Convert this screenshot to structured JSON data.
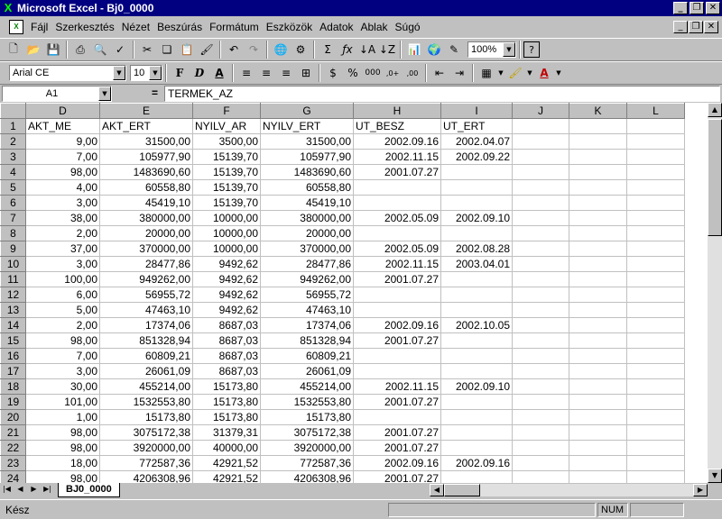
{
  "window": {
    "title": "Microsoft Excel - Bj0_0000"
  },
  "menu": [
    "Fájl",
    "Szerkesztés",
    "Nézet",
    "Beszúrás",
    "Formátum",
    "Eszközök",
    "Adatok",
    "Ablak",
    "Súgó"
  ],
  "toolbar": {
    "zoom": "100%",
    "font": "Arial CE",
    "size": "10",
    "bold": "F",
    "italic": "D",
    "underline": "A"
  },
  "formula": {
    "cell_ref": "A1",
    "equals": "=",
    "content": "TERMEK_AZ"
  },
  "columns": [
    "D",
    "E",
    "F",
    "G",
    "H",
    "I",
    "J",
    "K",
    "L"
  ],
  "rows": [
    {
      "n": "1",
      "c": [
        "AKT_ME",
        "AKT_ERT",
        "NYILV_AR",
        "NYILV_ERT",
        "UT_BESZ",
        "UT_ERT",
        "",
        "",
        ""
      ]
    },
    {
      "n": "2",
      "c": [
        "9,00",
        "31500,00",
        "3500,00",
        "31500,00",
        "2002.09.16",
        "2002.04.07",
        "",
        "",
        ""
      ]
    },
    {
      "n": "3",
      "c": [
        "7,00",
        "105977,90",
        "15139,70",
        "105977,90",
        "2002.11.15",
        "2002.09.22",
        "",
        "",
        ""
      ]
    },
    {
      "n": "4",
      "c": [
        "98,00",
        "1483690,60",
        "15139,70",
        "1483690,60",
        "2001.07.27",
        "",
        "",
        "",
        ""
      ]
    },
    {
      "n": "5",
      "c": [
        "4,00",
        "60558,80",
        "15139,70",
        "60558,80",
        "",
        "",
        "",
        "",
        ""
      ]
    },
    {
      "n": "6",
      "c": [
        "3,00",
        "45419,10",
        "15139,70",
        "45419,10",
        "",
        "",
        "",
        "",
        ""
      ]
    },
    {
      "n": "7",
      "c": [
        "38,00",
        "380000,00",
        "10000,00",
        "380000,00",
        "2002.05.09",
        "2002.09.10",
        "",
        "",
        ""
      ]
    },
    {
      "n": "8",
      "c": [
        "2,00",
        "20000,00",
        "10000,00",
        "20000,00",
        "",
        "",
        "",
        "",
        ""
      ]
    },
    {
      "n": "9",
      "c": [
        "37,00",
        "370000,00",
        "10000,00",
        "370000,00",
        "2002.05.09",
        "2002.08.28",
        "",
        "",
        ""
      ]
    },
    {
      "n": "10",
      "c": [
        "3,00",
        "28477,86",
        "9492,62",
        "28477,86",
        "2002.11.15",
        "2003.04.01",
        "",
        "",
        ""
      ]
    },
    {
      "n": "11",
      "c": [
        "100,00",
        "949262,00",
        "9492,62",
        "949262,00",
        "2001.07.27",
        "",
        "",
        "",
        ""
      ]
    },
    {
      "n": "12",
      "c": [
        "6,00",
        "56955,72",
        "9492,62",
        "56955,72",
        "",
        "",
        "",
        "",
        ""
      ]
    },
    {
      "n": "13",
      "c": [
        "5,00",
        "47463,10",
        "9492,62",
        "47463,10",
        "",
        "",
        "",
        "",
        ""
      ]
    },
    {
      "n": "14",
      "c": [
        "2,00",
        "17374,06",
        "8687,03",
        "17374,06",
        "2002.09.16",
        "2002.10.05",
        "",
        "",
        ""
      ]
    },
    {
      "n": "15",
      "c": [
        "98,00",
        "851328,94",
        "8687,03",
        "851328,94",
        "2001.07.27",
        "",
        "",
        "",
        ""
      ]
    },
    {
      "n": "16",
      "c": [
        "7,00",
        "60809,21",
        "8687,03",
        "60809,21",
        "",
        "",
        "",
        "",
        ""
      ]
    },
    {
      "n": "17",
      "c": [
        "3,00",
        "26061,09",
        "8687,03",
        "26061,09",
        "",
        "",
        "",
        "",
        ""
      ]
    },
    {
      "n": "18",
      "c": [
        "30,00",
        "455214,00",
        "15173,80",
        "455214,00",
        "2002.11.15",
        "2002.09.10",
        "",
        "",
        ""
      ]
    },
    {
      "n": "19",
      "c": [
        "101,00",
        "1532553,80",
        "15173,80",
        "1532553,80",
        "2001.07.27",
        "",
        "",
        "",
        ""
      ]
    },
    {
      "n": "20",
      "c": [
        "1,00",
        "15173,80",
        "15173,80",
        "15173,80",
        "",
        "",
        "",
        "",
        ""
      ]
    },
    {
      "n": "21",
      "c": [
        "98,00",
        "3075172,38",
        "31379,31",
        "3075172,38",
        "2001.07.27",
        "",
        "",
        "",
        ""
      ]
    },
    {
      "n": "22",
      "c": [
        "98,00",
        "3920000,00",
        "40000,00",
        "3920000,00",
        "2001.07.27",
        "",
        "",
        "",
        ""
      ]
    },
    {
      "n": "23",
      "c": [
        "18,00",
        "772587,36",
        "42921,52",
        "772587,36",
        "2002.09.16",
        "2002.09.16",
        "",
        "",
        ""
      ]
    },
    {
      "n": "24",
      "c": [
        "98,00",
        "4206308,96",
        "42921,52",
        "4206308,96",
        "2001.07.27",
        "",
        "",
        "",
        ""
      ]
    }
  ],
  "sheet": {
    "tab": "BJ0_0000"
  },
  "status": {
    "text": "Kész",
    "num": "NUM"
  }
}
